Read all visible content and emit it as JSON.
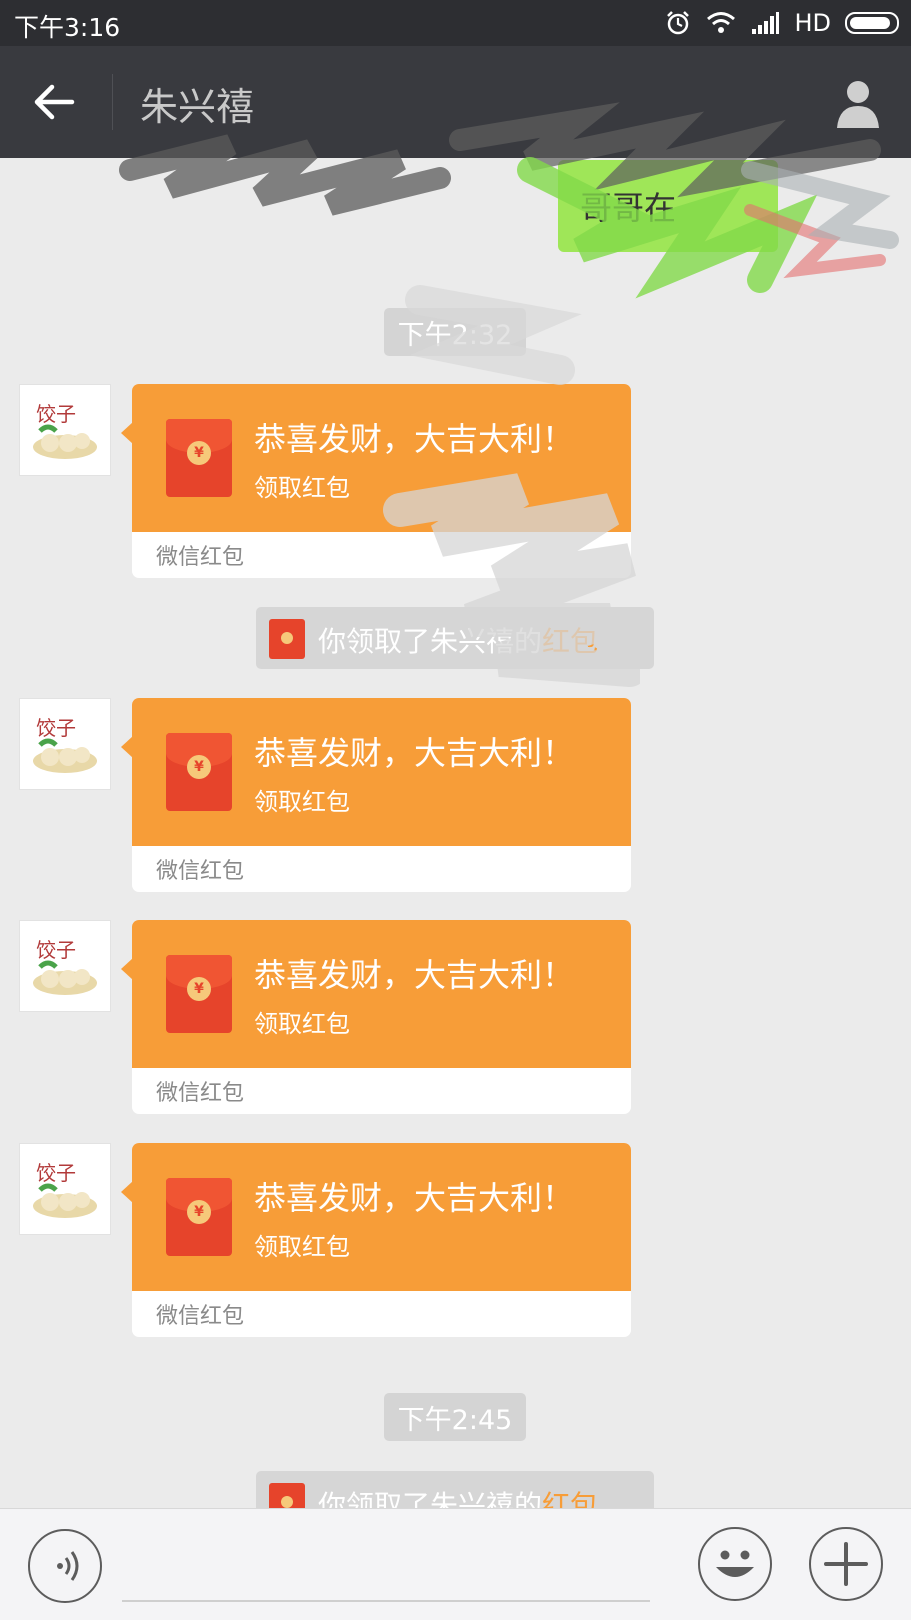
{
  "status_bar": {
    "time": "下午3:16",
    "network": "HD"
  },
  "header": {
    "title": "朱兴禧"
  },
  "messages": {
    "sent_bubble": "哥哥在",
    "time_1": "下午2:32",
    "time_2": "下午2:45",
    "red_packet": {
      "greeting": "恭喜发财，大吉大利！",
      "action": "领取红包",
      "footer": "微信红包",
      "coin": "¥"
    },
    "notice_1": {
      "prefix": "你领取了朱兴禧的",
      "link": "红包"
    },
    "notice_2": {
      "prefix": "你领取了朱兴禧的",
      "link": "红包"
    }
  },
  "colors": {
    "header_bg": "#393a3f",
    "packet_orange": "#f79d38",
    "packet_red": "#e6442b",
    "chat_bg": "#ebebeb",
    "sent_green": "#9fe658"
  },
  "icons": {
    "back": "arrow-left-icon",
    "profile": "person-icon",
    "voice": "voice-icon",
    "emoji": "smiley-icon",
    "more": "plus-icon"
  }
}
